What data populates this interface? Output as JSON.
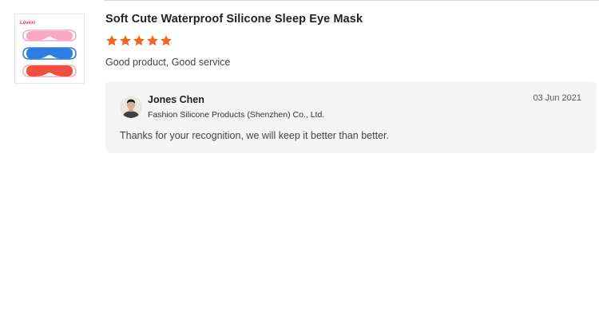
{
  "review": {
    "product_title": "Soft Cute Waterproof Silicone Sleep Eye Mask",
    "rating": 5,
    "rating_max": 5,
    "star_color": "#f26522",
    "comment": "Good product, Good service",
    "thumbnail": {
      "icon": "sleep-eye-mask-product-image",
      "brand_mark": "Lovexi",
      "mask_colors": [
        "#f7a8c4",
        "#2f7de1",
        "#f24e3f"
      ]
    }
  },
  "reply": {
    "name": "Jones Chen",
    "company": "Fashion Silicone Products (Shenzhen) Co., Ltd.",
    "date": "03 Jun 2021",
    "text": "Thanks for your recognition, we will keep it better than better.",
    "avatar_icon": "user-avatar",
    "background": "#f5f5f5"
  }
}
